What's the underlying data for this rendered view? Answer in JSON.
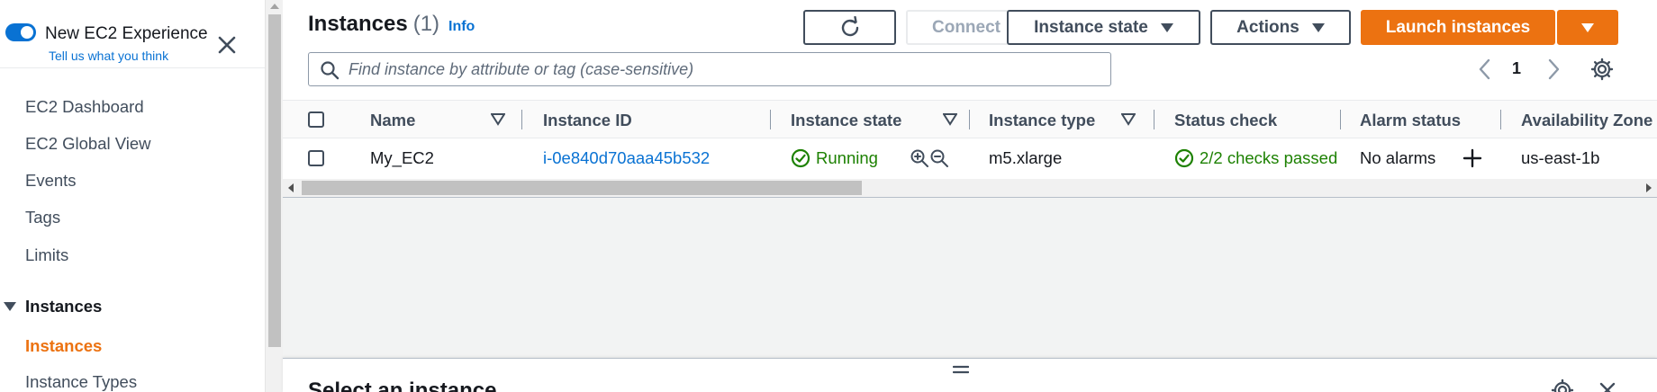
{
  "sidebar": {
    "toggle_label": "New EC2 Experience",
    "feedback_link": "Tell us what you think",
    "items": [
      {
        "label": "EC2 Dashboard"
      },
      {
        "label": "EC2 Global View"
      },
      {
        "label": "Events"
      },
      {
        "label": "Tags"
      },
      {
        "label": "Limits"
      }
    ],
    "section_label": "Instances",
    "section_items": [
      {
        "label": "Instances",
        "active": true
      },
      {
        "label": "Instance Types"
      }
    ]
  },
  "header": {
    "title": "Instances",
    "count": "(1)",
    "info_label": "Info",
    "buttons": {
      "connect": "Connect",
      "instance_state": "Instance state",
      "actions": "Actions",
      "launch": "Launch instances"
    }
  },
  "search": {
    "placeholder": "Find instance by attribute or tag (case-sensitive)",
    "value": ""
  },
  "pagination": {
    "current_page": "1"
  },
  "table": {
    "columns": [
      {
        "label": "Name"
      },
      {
        "label": "Instance ID"
      },
      {
        "label": "Instance state"
      },
      {
        "label": "Instance type"
      },
      {
        "label": "Status check"
      },
      {
        "label": "Alarm status"
      },
      {
        "label": "Availability Zone"
      }
    ],
    "rows": [
      {
        "name": "My_EC2",
        "instance_id": "i-0e840d70aaa45b532",
        "state": "Running",
        "type": "m5.xlarge",
        "status_check": "2/2 checks passed",
        "alarm_status": "No alarms",
        "availability_zone": "us-east-1b"
      }
    ]
  },
  "split_panel": {
    "title": "Select an instance"
  },
  "colors": {
    "accent": "#ec7211",
    "link": "#0972d3",
    "success": "#1d8102",
    "toggle": "#0972d3"
  },
  "icons": [
    "refresh-icon",
    "search-icon",
    "chevron-left-icon",
    "chevron-right-icon",
    "settings-icon",
    "close-icon",
    "sort-icon",
    "check-circle-icon",
    "zoom-in-icon",
    "zoom-out-icon",
    "plus-icon",
    "drag-handle-icon",
    "caret-down-icon"
  ]
}
